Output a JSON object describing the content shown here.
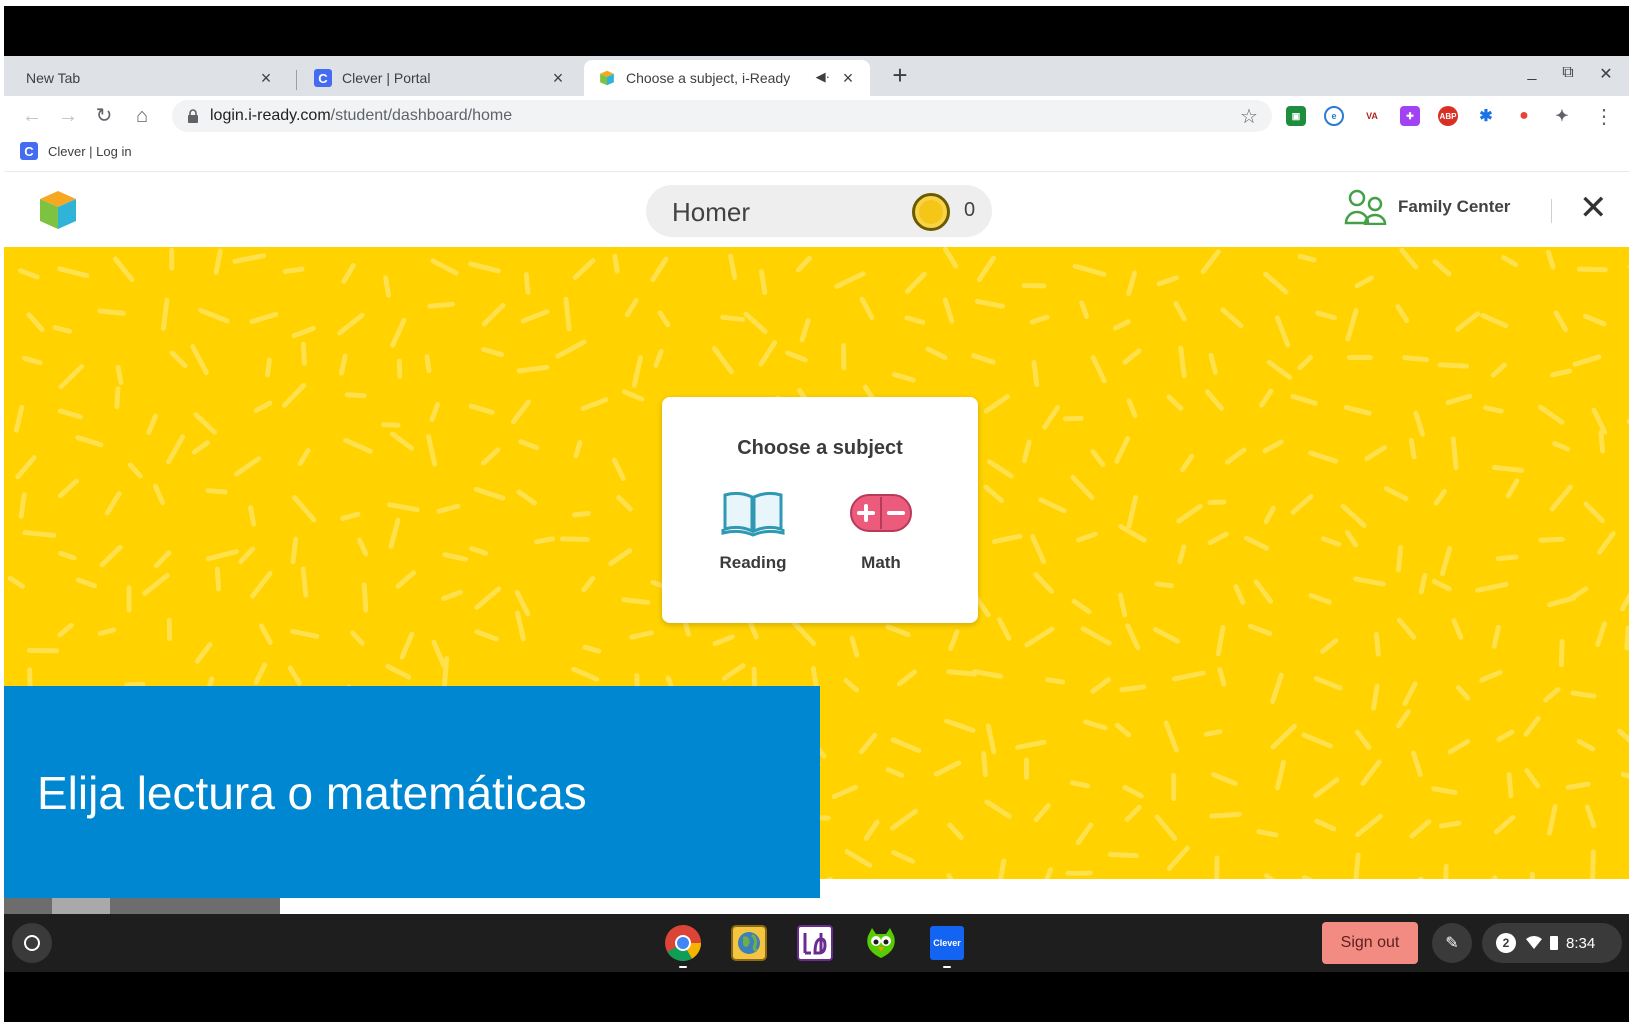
{
  "browser": {
    "tabs": [
      {
        "title": "New Tab",
        "active": false
      },
      {
        "title": "Clever | Portal",
        "active": false
      },
      {
        "title": "Choose a subject, i-Ready",
        "active": true
      }
    ],
    "url_host": "login.i-ready.com",
    "url_path": "/student/dashboard/home",
    "bookmarks": [
      {
        "label": "Clever | Log in"
      }
    ],
    "extensions": [
      "google-classroom-ext",
      "edpuzzle-ext",
      "vm-ext",
      "puzzle-ext",
      "adblock-plus-ext",
      "puzzle-blue-ext",
      "screencast-ext",
      "extensions-puzzle"
    ]
  },
  "header": {
    "student_name": "Homer",
    "coins": "0",
    "family_center_label": "Family Center"
  },
  "subject_card": {
    "title": "Choose a subject",
    "subjects": [
      {
        "label": "Reading",
        "icon": "open-book-icon"
      },
      {
        "label": "Math",
        "icon": "plus-minus-icon"
      }
    ]
  },
  "caption": {
    "text": "Elija lectura o matemáticas"
  },
  "shelf": {
    "apps": [
      "chrome",
      "earth-app",
      "literacy-app",
      "duolingo-app",
      "clever-app"
    ],
    "clever_label": "Clever",
    "sign_out_label": "Sign out",
    "notifications": "2",
    "time": "8:34"
  },
  "colors": {
    "background_yellow": "#ffd200",
    "caption_blue": "#0087d1",
    "math_pink": "#ec5a7c",
    "reading_teal": "#2f98b3",
    "sign_out_pink": "#f28b82"
  }
}
